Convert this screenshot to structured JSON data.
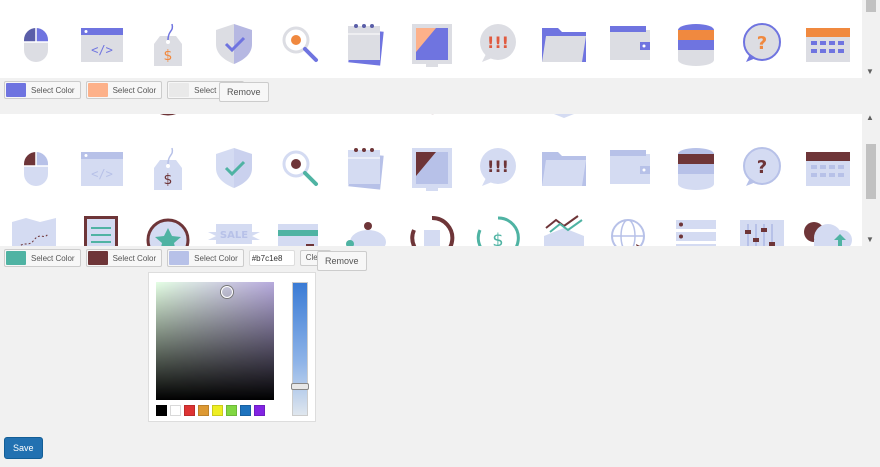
{
  "set1": {
    "select_label": "Select Color",
    "colors": [
      "#6f74e0",
      "#fdb18a",
      "#e9e9e9"
    ],
    "remove_label": "Remove"
  },
  "set2": {
    "select_label": "Select Color",
    "colors": [
      "#4fb3a3",
      "#6e3538",
      "#b7c1e8"
    ],
    "hex_value": "#b7c1e8",
    "clear_label": "Clear",
    "remove_label": "Remove"
  },
  "picker": {
    "palette": [
      "#000000",
      "#ffffff",
      "#dd3333",
      "#dd9933",
      "#eeee22",
      "#81d742",
      "#1e73be",
      "#8224e3"
    ]
  },
  "save_label": "Save",
  "icon_rows": {
    "row1": [
      "mouse-icon",
      "code-window-icon",
      "price-tag-icon",
      "shield-check-icon",
      "magnifier-icon",
      "notepad-icon",
      "picture-frame-icon",
      "alert-bubble-icon",
      "folder-icon",
      "wallet-icon",
      "database-icon",
      "question-bubble-icon",
      "calendar-icon"
    ],
    "row3": [
      "map-icon",
      "clipboard-icon",
      "star-badge-icon",
      "sale-banner-icon",
      "credit-card-icon",
      "piggy-bank-icon",
      "refresh-document-icon",
      "dollar-refresh-icon",
      "growth-box-icon",
      "globe-cursor-icon",
      "server-list-icon",
      "equalizer-icon",
      "cloud-upload-icon"
    ]
  }
}
